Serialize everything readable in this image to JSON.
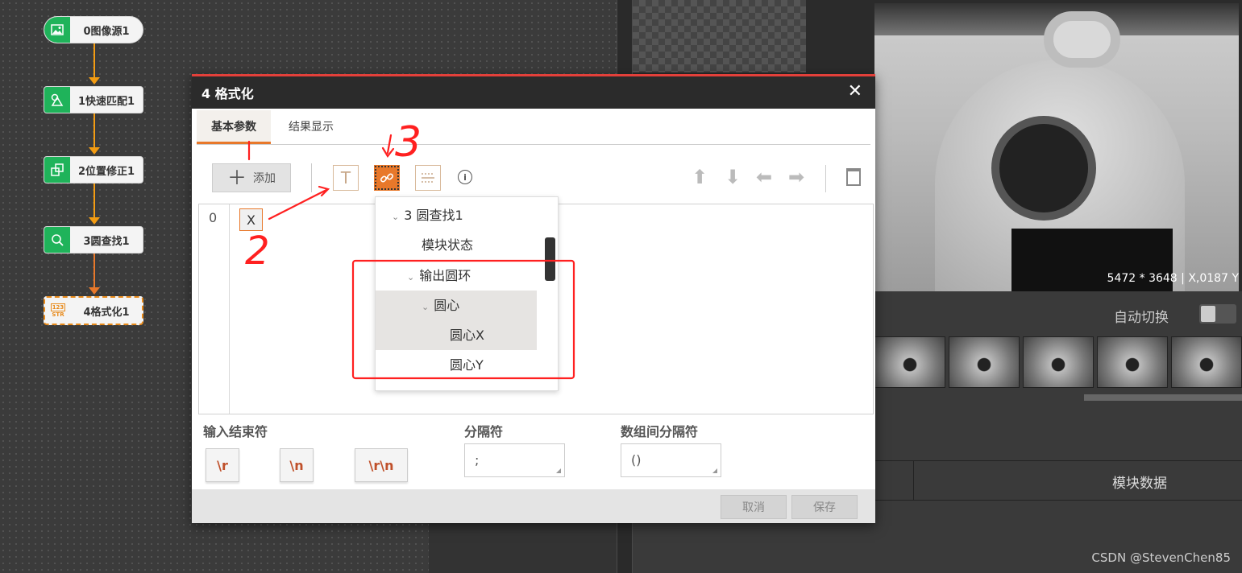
{
  "flow": {
    "nodes": [
      {
        "label": "0图像源1",
        "icon": "image-icon"
      },
      {
        "label": "1快速匹配1",
        "icon": "match-icon"
      },
      {
        "label": "2位置修正1",
        "icon": "position-icon"
      },
      {
        "label": "3圆查找1",
        "icon": "circle-search-icon"
      },
      {
        "label": "4格式化1",
        "icon": "format-str-icon",
        "icon_text_top": "123",
        "icon_text_bottom": "STR"
      }
    ]
  },
  "image_viewer": {
    "info": "5472 * 3648  |  X,0187  Y"
  },
  "thumbnails": {
    "auto_switch_label": "自动切换"
  },
  "data_panel": {
    "module_data_label": "模块数据"
  },
  "dialog": {
    "title": "4 格式化",
    "close_glyph": "✕",
    "tabs": [
      "基本参数",
      "结果显示"
    ],
    "toolbar": {
      "add_label": "添加",
      "add_glyph": "＋",
      "text_glyph": "T",
      "link_glyph": "🔗",
      "grid_glyph": "▦",
      "info_glyph": "i",
      "arrows": [
        "⬆",
        "⬇",
        "⬅",
        "➡"
      ]
    },
    "editor": {
      "line_number": "0",
      "token": "X"
    },
    "dropdown": {
      "items": [
        {
          "label": "3 圆查找1",
          "caret": "⌄"
        },
        {
          "label": "模块状态",
          "caret": ""
        },
        {
          "label": "输出圆环",
          "caret": "⌄"
        },
        {
          "label": "圆心",
          "caret": "⌄"
        },
        {
          "label": "圆心X",
          "caret": ""
        },
        {
          "label": "圆心Y",
          "caret": ""
        }
      ]
    },
    "labels": {
      "input_terminator": "输入结束符",
      "separator": "分隔符",
      "array_separator": "数组间分隔符"
    },
    "terminators": [
      "\\r",
      "\\n",
      "\\r\\n"
    ],
    "separator_value": ";",
    "array_separator_value": "()",
    "footer": {
      "cancel": "取消",
      "save": "保存"
    }
  },
  "annotations": {
    "labels": [
      "2",
      "3"
    ],
    "color": "#ff2020"
  },
  "watermark": "CSDN @StevenChen85"
}
